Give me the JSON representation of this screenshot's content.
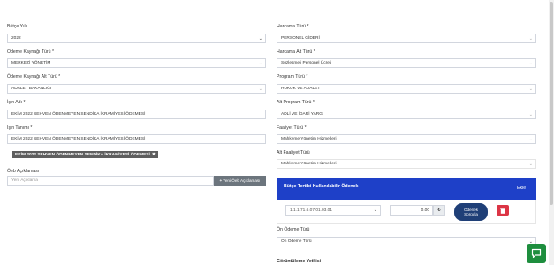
{
  "left": {
    "butce_yili": {
      "label": "Bütçe Yılı",
      "value": "2022"
    },
    "odeme_kaynagi_turu": {
      "label": "Ödeme Kaynağı Türü *",
      "value": "MERKEZİ YÖNETİM"
    },
    "odeme_kaynagi_alt_turu": {
      "label": "Ödeme Kaynağı Alt Türü *",
      "value": "ADALET BAKANLIĞI"
    },
    "is_adi": {
      "label": "İşin Adı *",
      "value": "EKİM 2022 SEHVEN ÖDENMEYEN SENDİKA İKRAMİYESİ ÖDEMESİ"
    },
    "is_tanimi": {
      "label": "İşin Tanımı *",
      "value": "EKİM 2022 SEHVEN ÖDENMEYEN SENDİKA İKRAMİYESİ ÖDEMESİ"
    },
    "tag": {
      "text": "EKİM 2022 SEHVEN ÖDENMEYEN SENDİKA İKRAMİYESİ ÖDEMESİ",
      "close": "✖"
    },
    "oeb": {
      "label": "Öeb Açıklaması",
      "placeholder": "Yeni Açıklama",
      "button": "Yeni Öeb Açıklaması",
      "button_icon": "+"
    }
  },
  "right": {
    "harcama_turu": {
      "label": "Harcama Türü *",
      "value": "PERSONEL GİDERİ"
    },
    "harcama_alt_turu": {
      "label": "Harcama Alt Türü *",
      "value": "Sözleşmeli Personel Ücreti"
    },
    "program_turu": {
      "label": "Program Türü *",
      "value": "HUKUK VE ADALET"
    },
    "alt_program_turu": {
      "label": "Alt Program Türü *",
      "value": "ADLİ VE İDARİ YARGI"
    },
    "faaliyet_turu": {
      "label": "Faaliyet Türü *",
      "value": "Mahkeme Yönetim Hizmetleri"
    },
    "alt_faaliyet_turu": {
      "label": "Alt Faaliyet Türü",
      "value": "Mahkeme Yönetim Hizmetleri"
    },
    "panel": {
      "title": "Bütçe Tertibi Kullanılabilir Ödenek",
      "add_link": "Ekle",
      "tertip_value": "1.1.1.71.6.07.01.03.01",
      "amount": "0.00",
      "amount_icon": "₺",
      "sorgula_line1": "Ödenek",
      "sorgula_line2": "Sorgula"
    },
    "on_odeme_turu": {
      "label": "Ön Ödeme Türü",
      "value": "Ön Ödeme Türü"
    },
    "goruntuleme_yetkisi": {
      "label": "Görüntüleme Yetkisi"
    }
  },
  "colors": {
    "panel_header": "#1e40c8",
    "delete_button": "#dc3545",
    "sorgula_button": "#1f3f77",
    "chat_button": "#1e8e3e"
  }
}
